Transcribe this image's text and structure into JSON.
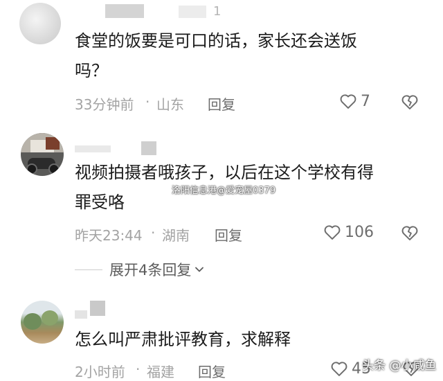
{
  "comments": [
    {
      "text_line1": "食堂的饭要是可口的话，家长还会送饭",
      "text_line2": "吗？",
      "time": "33分钟前",
      "location": "山东",
      "reply_label": "回复",
      "likes": "7",
      "name_fragment": "1"
    },
    {
      "text_line1": "视频拍摄者哦孩子，以后在这个学校有得",
      "text_line2": "罪受咯",
      "time": "昨天23:44",
      "location": "湖南",
      "reply_label": "回复",
      "likes": "106"
    },
    {
      "text_line1": "怎么叫严肃批评教育，求解释",
      "time": "2小时前",
      "location": "福建",
      "reply_label": "回复",
      "likes": "45"
    }
  ],
  "meta_separator": "·",
  "expand_replies": "展开4条回复",
  "watermark": "洛阳信息港@爱宠屋0379",
  "brand": "头条 @小咸鱼",
  "icons": {
    "like": "heart-outline-icon",
    "dislike": "broken-heart-icon",
    "expand": "chevron-down-icon"
  },
  "colors": {
    "text": "#1b1b1b",
    "meta": "#a3a3a3",
    "icon": "#6d6d6d"
  }
}
